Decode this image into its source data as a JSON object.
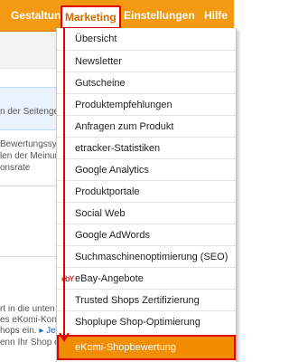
{
  "nav": {
    "gestaltung": "Gestaltung",
    "marketing": "Marketing",
    "einstellungen": "Einstellungen",
    "hilfe": "Hilfe"
  },
  "background": {
    "t1": "n der Seitenge",
    "t2": "Bewertungssys",
    "t3": "len der Meinun",
    "t4": "onsrate",
    "t5": "rt in die unten",
    "t6": "es eKomi-Kon",
    "t7_prefix": "hops ein. ",
    "t7_link": "▸ Jet",
    "t8": "enn Ihr Shop e"
  },
  "menu": {
    "items": [
      "Übersicht",
      "Newsletter",
      "Gutscheine",
      "Produktempfehlungen",
      "Anfragen zum Produkt",
      "etracker-Statistiken",
      "Google Analytics",
      "Produktportale",
      "Social Web",
      "Google AdWords",
      "Suchmaschinenoptimierung (SEO)",
      "eBay-Angebote",
      "Trusted Shops Zertifizierung",
      "Shoplupe Shop-Optimierung",
      "eKomi-Shopbewertung"
    ],
    "ebay_icon_text": "ebY"
  },
  "colors": {
    "nav_bg": "#f39a12",
    "highlight_bg": "#f28c00",
    "annotation_red": "#e00000"
  }
}
